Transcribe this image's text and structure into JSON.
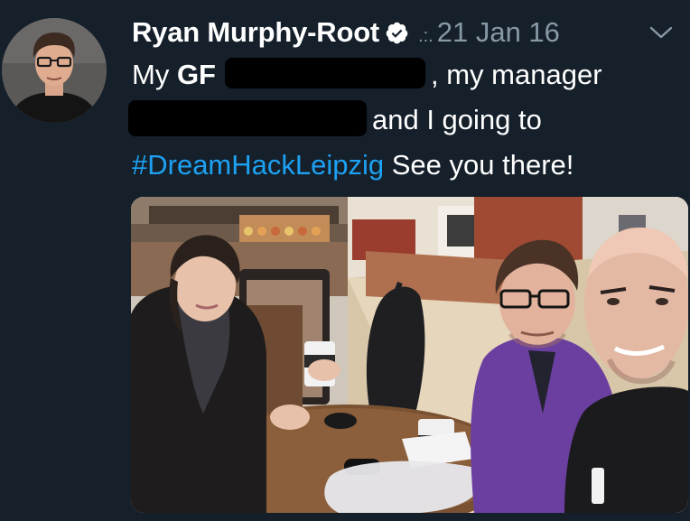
{
  "tweet": {
    "author": {
      "display_name": "Ryan Murphy-Root",
      "verified": true,
      "avatar": "profile-photo"
    },
    "separator": ".:.",
    "date": "21 Jan 16",
    "text": {
      "line1_prefix": "My ",
      "line1_bold": "GF",
      "line1_suffix": ", my manager",
      "line2": "and I going to",
      "hashtag": "#DreamHackLeipzig",
      "line3_suffix": " See you there!"
    },
    "media": {
      "type": "photo"
    }
  },
  "colors": {
    "background": "#15202b",
    "text": "#ffffff",
    "muted": "#8899a6",
    "link": "#1da1f2"
  },
  "icons": {
    "verified": "verified-badge-icon",
    "menu": "chevron-down-icon"
  }
}
